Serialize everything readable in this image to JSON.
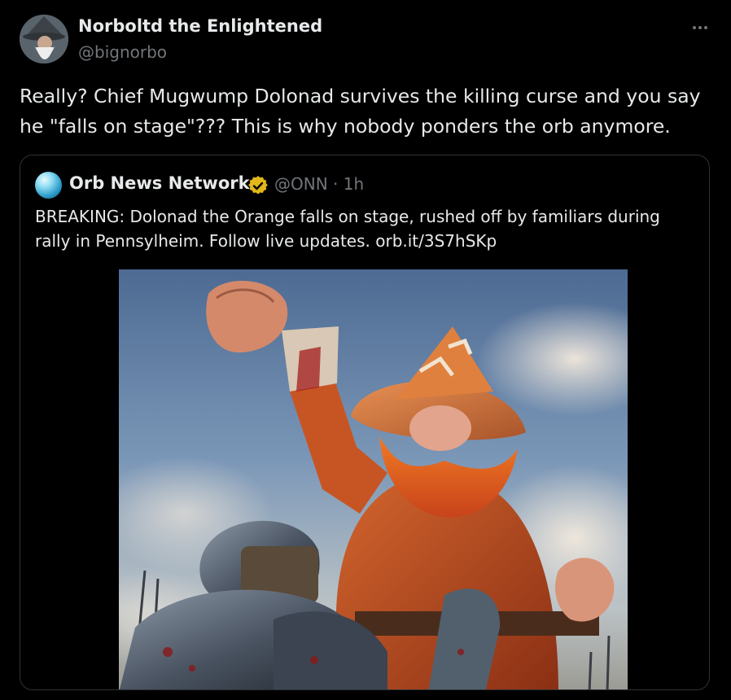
{
  "post": {
    "author_name": "Norboltd the Enlightened",
    "author_handle": "@bignorbo",
    "text": "Really? Chief Mugwump Dolonad survives the killing curse and you say he \"falls on stage\"??? This is why nobody ponders the orb anymore."
  },
  "quote": {
    "author_name": "Orb News Network",
    "author_handle": "@ONN",
    "separator": "·",
    "time": "1h",
    "text": "BREAKING: Dolonad the Orange falls on stage, rushed off by familiars during rally in Pennsylheim. Follow live updates. orb.it/3S7hSKp"
  },
  "icons": {
    "more": "more-horizontal-icon",
    "verified": "verified-badge-icon"
  },
  "colors": {
    "background": "#000000",
    "text_primary": "#e7e9ea",
    "text_secondary": "#71767b",
    "border": "#2f3336",
    "verified_badge": "#e2b719"
  }
}
